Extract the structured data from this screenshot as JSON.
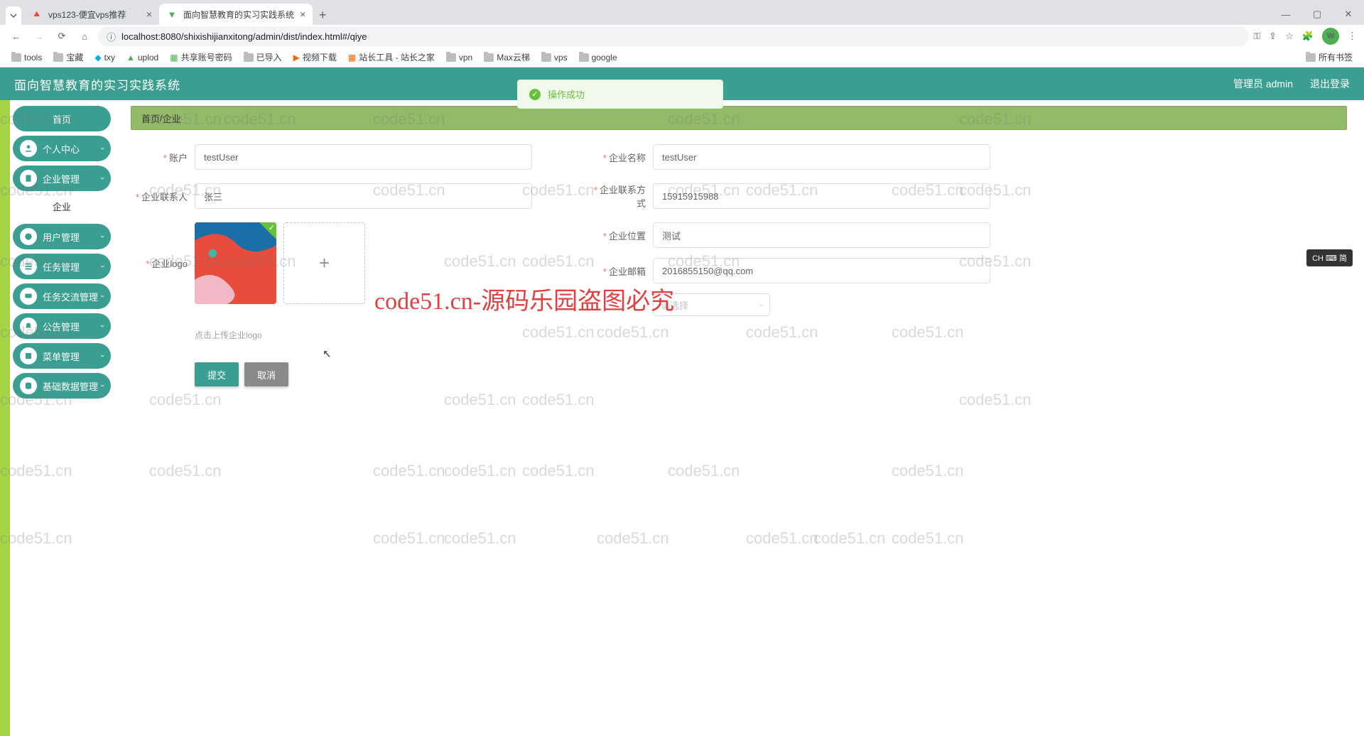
{
  "browser": {
    "tabs": [
      {
        "title": "vps123-便宜vps推荐",
        "active": false
      },
      {
        "title": "面向智慧教育的实习实践系统",
        "active": true
      }
    ],
    "url": "localhost:8080/shixishijianxitong/admin/dist/index.html#/qiye",
    "avatar_letter": "W",
    "bookmarks": [
      "tools",
      "宝藏",
      "txy",
      "uplod",
      "共享账号密码",
      "已导入",
      "视频下载",
      "站长工具 - 站长之家",
      "vpn",
      "Max云梯",
      "vps",
      "google"
    ],
    "all_bookmarks": "所有书签"
  },
  "app": {
    "header_title": "面向智慧教育的实习实践系统",
    "admin_label": "管理员 admin",
    "logout": "退出登录"
  },
  "notify": {
    "text": "操作成功"
  },
  "sidebar": {
    "home": "首页",
    "items": [
      {
        "label": "个人中心",
        "icon": "user"
      },
      {
        "label": "企业管理",
        "icon": "building"
      },
      {
        "label": "用户管理",
        "icon": "users"
      },
      {
        "label": "任务管理",
        "icon": "list"
      },
      {
        "label": "任务交流管理",
        "icon": "comment"
      },
      {
        "label": "公告管理",
        "icon": "bell"
      },
      {
        "label": "菜单管理",
        "icon": "menu"
      },
      {
        "label": "基础数据管理",
        "icon": "data"
      }
    ],
    "sub_enterprise": "企业"
  },
  "breadcrumb": {
    "home": "首页",
    "sep": " / ",
    "current": "企业"
  },
  "form": {
    "account_label": "账户",
    "account_value": "testUser",
    "name_label": "企业名称",
    "name_value": "testUser",
    "contact_label": "企业联系人",
    "contact_value": "张三",
    "phone_label": "企业联系方式",
    "phone_value": "15915915988",
    "logo_label": "企业logo",
    "location_label": "企业位置",
    "location_value": "测试",
    "email_label": "企业邮箱",
    "email_value": "2016855150@qq.com",
    "select_placeholder": "请选择",
    "upload_hint": "点击上传企业logo",
    "submit": "提交",
    "cancel": "取消"
  },
  "watermark": {
    "text": "code51.cn",
    "big": "code51.cn-源码乐园盗图必究"
  },
  "ime": "CH ⌨ 简"
}
